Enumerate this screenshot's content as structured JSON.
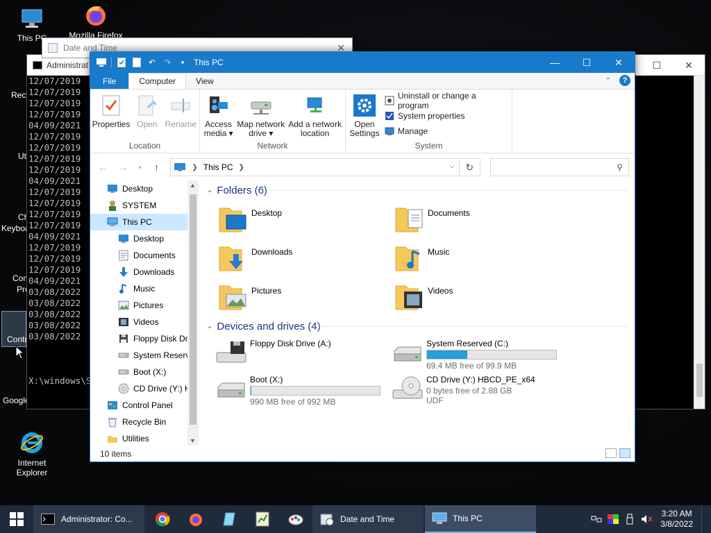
{
  "desktop": {
    "icons": [
      {
        "label": "This PC"
      },
      {
        "label": "Mozilla Firefox"
      },
      {
        "label": "Internet Explorer"
      }
    ],
    "partial_labels": [
      "Recy",
      "Ut",
      "Ch",
      "Keyboa",
      "Con",
      "Pro",
      "Contr",
      "Google"
    ]
  },
  "cmd": {
    "title": "Administrat",
    "lines": [
      "12/07/2019",
      "12/07/2019",
      "12/07/2019",
      "12/07/2019",
      "04/09/2021",
      "12/07/2019",
      "12/07/2019",
      "12/07/2019",
      "12/07/2019",
      "04/09/2021",
      "12/07/2019",
      "12/07/2019",
      "12/07/2019",
      "12/07/2019",
      "04/09/2021",
      "12/07/2019",
      "12/07/2019",
      "12/07/2019",
      "04/09/2021",
      "03/08/2022",
      "03/08/2022",
      "03/08/2022",
      "03/08/2022",
      "03/08/2022"
    ],
    "prompt": "X:\\windows\\S"
  },
  "datetime_window": {
    "title": "Date and Time"
  },
  "explorer": {
    "title": "This PC",
    "tabs": {
      "file": "File",
      "computer": "Computer",
      "view": "View"
    },
    "ribbon": {
      "location": {
        "label": "Location",
        "properties": "Properties",
        "open": "Open",
        "rename": "Rename"
      },
      "network": {
        "label": "Network",
        "access_media": "Access media ▾",
        "map_drive": "Map network drive ▾",
        "add_location": "Add a network location"
      },
      "system": {
        "label": "System",
        "open_settings": "Open Settings",
        "uninstall": "Uninstall or change a program",
        "system_properties": "System properties",
        "manage": "Manage"
      }
    },
    "address": {
      "crumb": "This PC",
      "search_placeholder": ""
    },
    "nav_items": [
      {
        "label": "Desktop",
        "icon": "desktop-icon",
        "indent": 1
      },
      {
        "label": "SYSTEM",
        "icon": "user-icon",
        "indent": 1
      },
      {
        "label": "This PC",
        "icon": "computer-icon",
        "indent": 1,
        "selected": true
      },
      {
        "label": "Desktop",
        "icon": "desktop-icon",
        "indent": 2
      },
      {
        "label": "Documents",
        "icon": "documents-icon",
        "indent": 2
      },
      {
        "label": "Downloads",
        "icon": "downloads-icon",
        "indent": 2
      },
      {
        "label": "Music",
        "icon": "music-icon",
        "indent": 2
      },
      {
        "label": "Pictures",
        "icon": "pictures-icon",
        "indent": 2
      },
      {
        "label": "Videos",
        "icon": "videos-icon",
        "indent": 2
      },
      {
        "label": "Floppy Disk Dri",
        "icon": "floppy-icon",
        "indent": 2
      },
      {
        "label": "System Reserve",
        "icon": "drive-icon",
        "indent": 2
      },
      {
        "label": "Boot (X:)",
        "icon": "drive-icon",
        "indent": 2
      },
      {
        "label": "CD Drive (Y:) H",
        "icon": "cd-icon",
        "indent": 2
      },
      {
        "label": "Control Panel",
        "icon": "control-panel-icon",
        "indent": 1
      },
      {
        "label": "Recycle Bin",
        "icon": "recycle-bin-icon",
        "indent": 1
      },
      {
        "label": "Utilities",
        "icon": "folder-icon",
        "indent": 1
      }
    ],
    "folders_header": "Folders (6)",
    "folders": [
      {
        "name": "Desktop",
        "overlay": "desktop"
      },
      {
        "name": "Documents",
        "overlay": "documents"
      },
      {
        "name": "Downloads",
        "overlay": "downloads"
      },
      {
        "name": "Music",
        "overlay": "music"
      },
      {
        "name": "Pictures",
        "overlay": "pictures"
      },
      {
        "name": "Videos",
        "overlay": "videos"
      }
    ],
    "drives_header": "Devices and drives (4)",
    "drives": [
      {
        "name": "Floppy Disk Drive (A:)",
        "type": "floppy"
      },
      {
        "name": "System Reserved (C:)",
        "type": "hdd",
        "free": "69.4 MB free of 99.9 MB",
        "used_fraction": 0.31
      },
      {
        "name": "Boot (X:)",
        "type": "hdd",
        "free": "990 MB free of 992 MB",
        "used_fraction": 0.002
      },
      {
        "name": "CD Drive (Y:) HBCD_PE_x64",
        "type": "cd",
        "free": "0 bytes free of 2.88 GB",
        "fs": "UDF"
      }
    ],
    "status": "10 items"
  },
  "taskbar": {
    "tasks": [
      {
        "label": "Administrator: Co..."
      },
      {
        "label": "Date and Time"
      },
      {
        "label": "This PC"
      }
    ],
    "time": "3:20 AM",
    "date": "3/8/2022"
  },
  "colors": {
    "accent": "#1979ca",
    "bar_fill": "#26a0da",
    "selection": "#cce8ff",
    "folder": "#f4c95a"
  }
}
